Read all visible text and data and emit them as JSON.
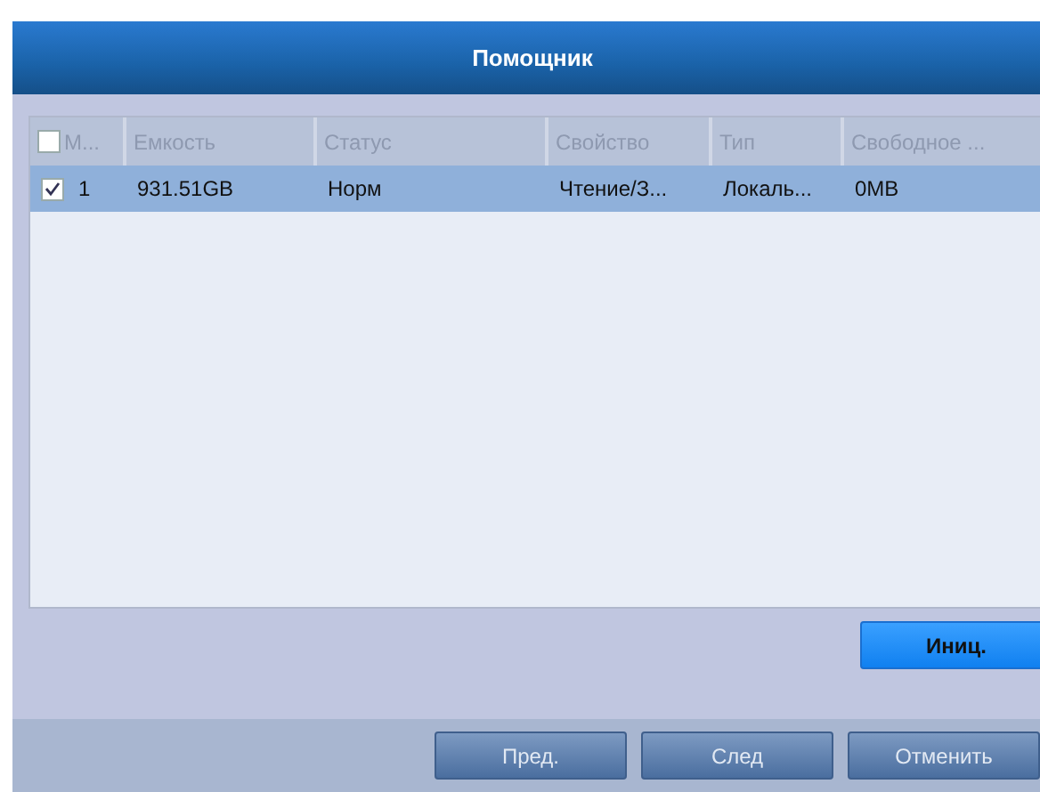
{
  "window": {
    "title": "Помощник"
  },
  "table": {
    "header_checkbox": {
      "checked": false
    },
    "columns": [
      "М...",
      "Емкость",
      "Статус",
      "Свойство",
      "Тип",
      "Свободное ..."
    ],
    "rows": [
      {
        "checked": true,
        "selected": true,
        "cells": [
          "1",
          "931.51GB",
          "Норм",
          "Чтение/З...",
          "Локаль...",
          "0MB"
        ]
      }
    ]
  },
  "init_button": {
    "label": "Иниц.",
    "disabled": false
  },
  "footer_buttons": [
    {
      "label": "Пред.",
      "disabled": true
    },
    {
      "label": "След",
      "disabled": true
    },
    {
      "label": "Отменить",
      "disabled": true
    }
  ]
}
